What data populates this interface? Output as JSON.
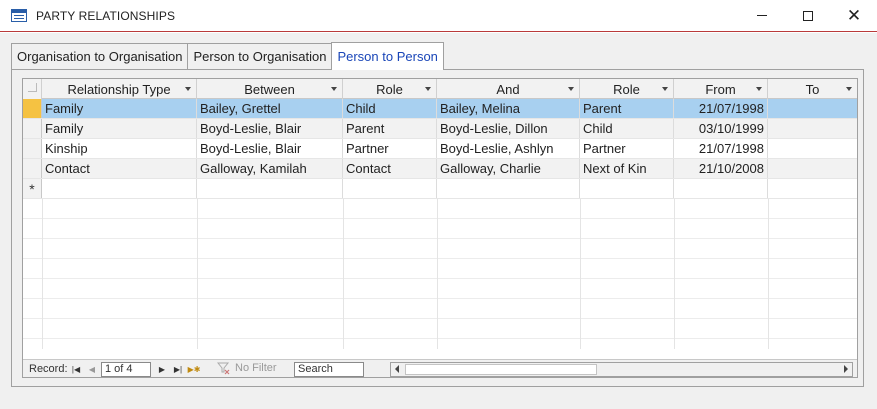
{
  "window": {
    "title": "PARTY RELATIONSHIPS",
    "icon": "form-icon",
    "controls": [
      "minimize-icon",
      "maximize-icon",
      "close-icon"
    ]
  },
  "tabs": [
    {
      "label": "Organisation to Organisation",
      "active": false
    },
    {
      "label": "Person to Organisation",
      "active": false
    },
    {
      "label": "Person to Person",
      "active": true
    }
  ],
  "columns": [
    {
      "label": "Relationship Type",
      "dropdown": true
    },
    {
      "label": "Between",
      "dropdown": true
    },
    {
      "label": "Role",
      "dropdown": true
    },
    {
      "label": "And",
      "dropdown": true
    },
    {
      "label": "Role",
      "dropdown": true
    },
    {
      "label": "From",
      "dropdown": true
    },
    {
      "label": "To",
      "dropdown": true
    }
  ],
  "rows": [
    [
      "Family",
      "Bailey, Grettel",
      "Child",
      "Bailey, Melina",
      "Parent",
      "21/07/1998",
      ""
    ],
    [
      "Family",
      "Boyd-Leslie, Blair",
      "Parent",
      "Boyd-Leslie, Dillon",
      "Child",
      "03/10/1999",
      ""
    ],
    [
      "Kinship",
      "Boyd-Leslie, Blair",
      "Partner",
      "Boyd-Leslie, Ashlyn",
      "Partner",
      "21/07/1998",
      ""
    ],
    [
      "Contact",
      "Galloway, Kamilah",
      "Contact",
      "Galloway, Charlie",
      "Next of Kin",
      "21/10/2008",
      ""
    ]
  ],
  "selected_row": 0,
  "new_row_marker": "*",
  "navigation": {
    "record_label": "Record:",
    "position": "1 of 4",
    "filter_label": "No Filter",
    "search_label": "Search"
  },
  "colors": {
    "selected_row": "#a8d0f0",
    "row_selector_active": "#f5c242",
    "active_tab_text": "#1a46b8"
  }
}
